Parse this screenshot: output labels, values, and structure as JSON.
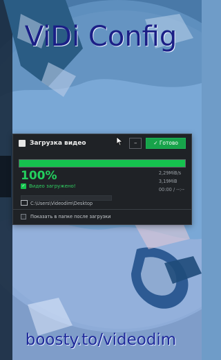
{
  "overlay": {
    "title": "ViDi Config",
    "footer": "boosty.to/videodim"
  },
  "dialog": {
    "title": "Загрузка видео",
    "minimize_label": "–",
    "done_label": "✓ Готово",
    "progress_fraction": 1.0,
    "percent": "100%",
    "status": "Видео загружено!",
    "stats": [
      "2,29MiB/s",
      "3,19MiB",
      "00:00 / --:--"
    ],
    "path": "C:\\Users\\Videodim\\Desktop",
    "checkbox_label": "Показать в папке после загрузки"
  },
  "colors": {
    "accent_green": "#15c24e",
    "dialog_bg": "#1f2226",
    "title_blue": "#1b1f86"
  },
  "icons": {
    "header_icon": "download-icon",
    "folder_icon": "folder-icon",
    "check_icon": "check-icon",
    "cursor_icon": "cursor-icon"
  }
}
